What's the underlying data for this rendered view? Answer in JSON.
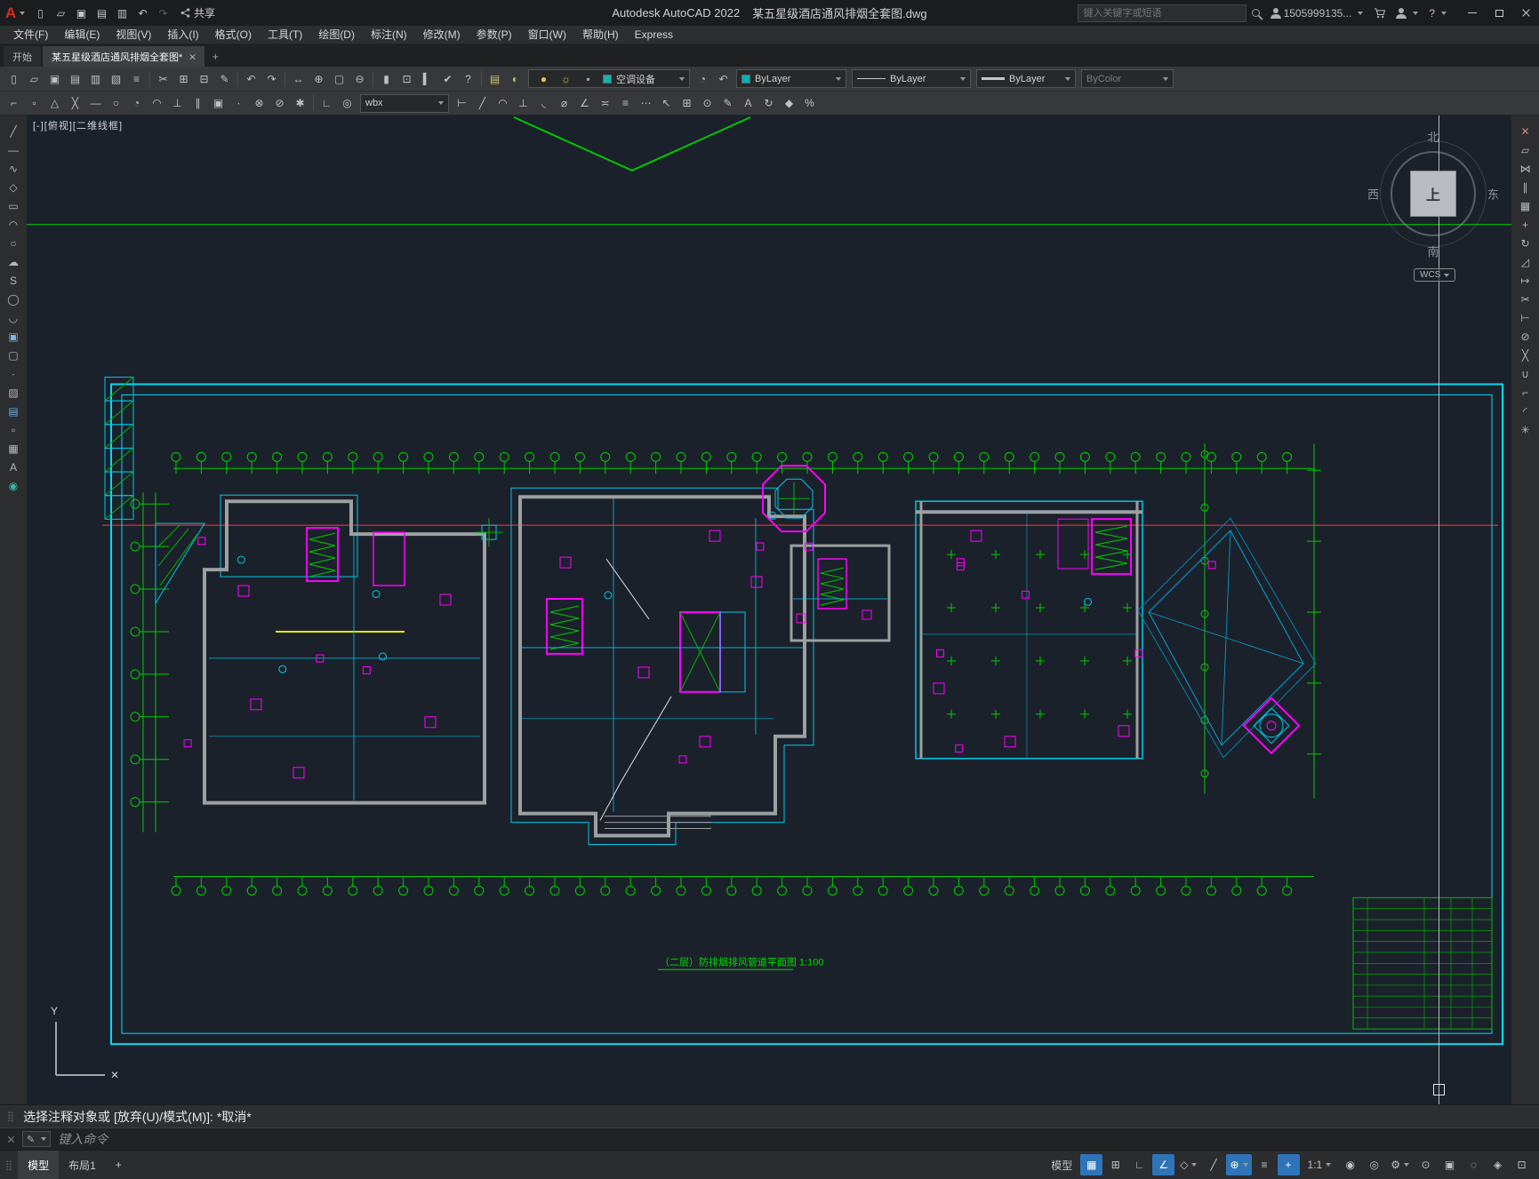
{
  "titlebar": {
    "logo_glyph": "A",
    "quick_access": [
      {
        "name": "new-file-icon",
        "glyph": "▯"
      },
      {
        "name": "open-file-icon",
        "glyph": "▱"
      },
      {
        "name": "save-icon",
        "glyph": "▣"
      },
      {
        "name": "save-as-icon",
        "glyph": "▤"
      },
      {
        "name": "plot-icon",
        "glyph": "▥"
      },
      {
        "name": "undo-icon",
        "glyph": "↶"
      },
      {
        "name": "redo-icon",
        "glyph": "↷",
        "disabled": true
      }
    ],
    "share_label": "共享",
    "app_title": "Autodesk AutoCAD 2022",
    "doc_title": "某五星级酒店通风排烟全套图.dwg",
    "search_placeholder": "键入关键字或短语",
    "account_name": "1505999135...",
    "help_label": "?"
  },
  "menubar": {
    "items": [
      "文件(F)",
      "编辑(E)",
      "视图(V)",
      "插入(I)",
      "格式(O)",
      "工具(T)",
      "绘图(D)",
      "标注(N)",
      "修改(M)",
      "参数(P)",
      "窗口(W)",
      "帮助(H)",
      "Express"
    ]
  },
  "filetabs": {
    "start_tab": "开始",
    "doc_tab": "某五星级酒店通风排烟全套图*",
    "new_tab_glyph": "+"
  },
  "toolbar1": {
    "icons": [
      {
        "name": "new-file-icon",
        "glyph": "▯"
      },
      {
        "name": "open-file-icon",
        "glyph": "▱"
      },
      {
        "name": "save-icon",
        "glyph": "▣"
      },
      {
        "name": "save-all-icon",
        "glyph": "▤"
      },
      {
        "name": "plot-icon",
        "glyph": "▥"
      },
      {
        "name": "plot-preview-icon",
        "glyph": "▧"
      },
      {
        "name": "publish-icon",
        "glyph": "≡"
      },
      {
        "sep": true
      },
      {
        "name": "cut-icon",
        "glyph": "✂"
      },
      {
        "name": "copy-clip-icon",
        "glyph": "⊞"
      },
      {
        "name": "paste-icon",
        "glyph": "⊟"
      },
      {
        "name": "match-properties-icon",
        "glyph": "✎"
      },
      {
        "sep": true
      },
      {
        "name": "undo-icon",
        "glyph": "↶"
      },
      {
        "name": "redo-icon",
        "glyph": "↷",
        "disabled": true
      },
      {
        "sep": true
      },
      {
        "name": "pan-icon",
        "glyph": "↔"
      },
      {
        "name": "zoom-realtime-icon",
        "glyph": "⊕"
      },
      {
        "name": "zoom-window-icon",
        "glyph": "▢"
      },
      {
        "name": "zoom-previous-icon",
        "glyph": "⊖"
      },
      {
        "sep": true
      },
      {
        "name": "properties-icon",
        "glyph": "▮"
      },
      {
        "name": "designcenter-icon",
        "glyph": "⊡"
      },
      {
        "name": "tool-palettes-icon",
        "glyph": "▍"
      },
      {
        "name": "markup-icon",
        "glyph": "✔"
      },
      {
        "name": "help-icon",
        "glyph": "?"
      }
    ],
    "layer_tools": [
      {
        "name": "layer-properties-icon",
        "glyph": "▤",
        "color": "#d3c06a"
      },
      {
        "name": "layer-states-icon",
        "glyph": "◐",
        "color": "#e0c84a"
      }
    ],
    "layer_dropdown": {
      "icons": [
        {
          "name": "layer-on-icon",
          "glyph": "●",
          "color": "#e8c33a"
        },
        {
          "name": "layer-thaw-icon",
          "glyph": "☼",
          "color": "#e8c33a"
        },
        {
          "name": "layer-lock-icon",
          "glyph": "▪",
          "color": "#9fb3bd"
        }
      ],
      "swatch": "#19b0b0",
      "value": "空调设备"
    },
    "after_layer_icons": [
      {
        "name": "layer-make-current-icon",
        "glyph": "◔"
      },
      {
        "name": "layer-previous-icon",
        "glyph": "↶"
      }
    ],
    "color_dropdown": {
      "swatch": "#00b0ba",
      "value": "ByLayer"
    },
    "linetype_dropdown": {
      "value": "ByLayer"
    },
    "lineweight_dropdown": {
      "value": "ByLayer"
    },
    "plotstyle_dropdown": {
      "value": "ByColor"
    }
  },
  "toolbar2": {
    "icons_left": [
      {
        "name": "osnap-from-icon",
        "glyph": "⌐"
      },
      {
        "name": "osnap-endpoint-icon",
        "glyph": "▫"
      },
      {
        "name": "osnap-midpoint-icon",
        "glyph": "△"
      },
      {
        "name": "osnap-intersection-icon",
        "glyph": "╳"
      },
      {
        "name": "osnap-extension-icon",
        "glyph": "—"
      },
      {
        "name": "osnap-center-icon",
        "glyph": "○"
      },
      {
        "name": "osnap-quadrant-icon",
        "glyph": "◔"
      },
      {
        "name": "osnap-tangent-icon",
        "glyph": "◠"
      },
      {
        "name": "osnap-perpendicular-icon",
        "glyph": "⊥"
      },
      {
        "name": "osnap-parallel-icon",
        "glyph": "∥"
      },
      {
        "name": "osnap-insert-icon",
        "glyph": "▣"
      },
      {
        "name": "osnap-node-icon",
        "glyph": "∙"
      },
      {
        "name": "osnap-nearest-icon",
        "glyph": "⊗"
      },
      {
        "name": "osnap-none-icon",
        "glyph": "⊘"
      },
      {
        "name": "osnap-settings-icon",
        "glyph": "✱"
      },
      {
        "sep": true
      },
      {
        "name": "ucs-icon",
        "glyph": "∟"
      },
      {
        "name": "ucs-world-icon",
        "glyph": "◎"
      }
    ],
    "style_dropdown": {
      "value": "wbx"
    },
    "icons_right": [
      {
        "name": "dim-linear-icon",
        "glyph": "⊢"
      },
      {
        "name": "dim-aligned-icon",
        "glyph": "╱"
      },
      {
        "name": "dim-arc-icon",
        "glyph": "◠"
      },
      {
        "name": "dim-ordinate-icon",
        "glyph": "⊥"
      },
      {
        "name": "dim-radius-icon",
        "glyph": "◟"
      },
      {
        "name": "dim-diameter-icon",
        "glyph": "⌀"
      },
      {
        "name": "dim-angular-icon",
        "glyph": "∠"
      },
      {
        "name": "quick-dim-icon",
        "glyph": "≍"
      },
      {
        "name": "dim-baseline-icon",
        "glyph": "≡"
      },
      {
        "name": "dim-continue-icon",
        "glyph": "⋯"
      },
      {
        "name": "leader-icon",
        "glyph": "↖"
      },
      {
        "name": "tolerance-icon",
        "glyph": "⊞"
      },
      {
        "name": "center-mark-icon",
        "glyph": "⊙"
      },
      {
        "name": "dim-edit-icon",
        "glyph": "✎"
      },
      {
        "name": "dim-text-edit-icon",
        "glyph": "A"
      },
      {
        "name": "dim-update-icon",
        "glyph": "↻"
      },
      {
        "name": "dim-style-icon",
        "glyph": "◆"
      },
      {
        "name": "scale-list-icon",
        "glyph": "%"
      }
    ]
  },
  "left_toolbar": {
    "icons": [
      {
        "name": "line-tool",
        "glyph": "╱"
      },
      {
        "name": "construction-line-tool",
        "glyph": "—"
      },
      {
        "name": "polyline-tool",
        "glyph": "∿"
      },
      {
        "name": "polygon-tool",
        "glyph": "◇"
      },
      {
        "name": "rectangle-tool",
        "glyph": "▭"
      },
      {
        "name": "arc-tool",
        "glyph": "◠"
      },
      {
        "name": "circle-tool",
        "glyph": "○"
      },
      {
        "name": "revision-cloud-tool",
        "glyph": "☁"
      },
      {
        "name": "spline-tool",
        "glyph": "S"
      },
      {
        "name": "ellipse-tool",
        "glyph": "◯"
      },
      {
        "name": "ellipse-arc-tool",
        "glyph": "◡"
      },
      {
        "name": "insert-block-tool",
        "glyph": "▣",
        "color": "#7fb2e5"
      },
      {
        "name": "make-block-tool",
        "glyph": "▢"
      },
      {
        "name": "point-tool",
        "glyph": "∙"
      },
      {
        "name": "hatch-tool",
        "glyph": "▨"
      },
      {
        "name": "gradient-tool",
        "glyph": "▤",
        "color": "#6fa8dc"
      },
      {
        "name": "region-tool",
        "glyph": "▫"
      },
      {
        "name": "table-tool",
        "glyph": "▦"
      },
      {
        "name": "mtext-tool",
        "glyph": "A"
      },
      {
        "name": "measure-tool",
        "glyph": "◉",
        "color": "#35b8a0"
      }
    ]
  },
  "right_toolbar": {
    "icons": [
      {
        "name": "erase-tool",
        "glyph": "✕",
        "color": "#d98a7a"
      },
      {
        "name": "copy-tool",
        "glyph": "▱"
      },
      {
        "name": "mirror-tool",
        "glyph": "⋈"
      },
      {
        "name": "offset-tool",
        "glyph": "∥"
      },
      {
        "name": "array-tool",
        "glyph": "▦"
      },
      {
        "name": "move-tool",
        "glyph": "+"
      },
      {
        "name": "rotate-tool",
        "glyph": "↻"
      },
      {
        "name": "scale-tool",
        "glyph": "◿"
      },
      {
        "name": "stretch-tool",
        "glyph": "↦"
      },
      {
        "name": "trim-tool",
        "glyph": "✂"
      },
      {
        "name": "extend-tool",
        "glyph": "⊢"
      },
      {
        "name": "break-point-tool",
        "glyph": "⊘"
      },
      {
        "name": "break-tool",
        "glyph": "╳"
      },
      {
        "name": "join-tool",
        "glyph": "∪"
      },
      {
        "name": "chamfer-tool",
        "glyph": "⌐"
      },
      {
        "name": "fillet-tool",
        "glyph": "◜"
      },
      {
        "name": "explode-tool",
        "glyph": "✳"
      }
    ]
  },
  "canvas": {
    "viewport_label": "[-][俯视][二维线框]",
    "plan_title": "（二层）防排烟排风管道平面图 1:100",
    "compass": {
      "north": "北",
      "south": "南",
      "west": "西",
      "east": "东",
      "top": "上"
    },
    "wcs_label": "WCS",
    "ucs": {
      "x_label": "✕",
      "y_label": "Y"
    }
  },
  "cmdline": {
    "history": "选择注释对象或 [放弃(U)/模式(M)]: *取消*",
    "placeholder": "键入命令"
  },
  "statusbar": {
    "model_tab": "模型",
    "layout_tab": "布局1",
    "new_layout_glyph": "+",
    "right_items": [
      {
        "name": "model-space-button",
        "label": "模型"
      },
      {
        "name": "grid-icon",
        "glyph": "▦",
        "active": true
      },
      {
        "name": "snap-icon",
        "glyph": "⊞"
      },
      {
        "name": "ortho-icon",
        "glyph": "∟"
      },
      {
        "name": "polar-icon",
        "glyph": "∠",
        "active": true
      },
      {
        "name": "isodraft-icon",
        "glyph": "◇",
        "dd": true
      },
      {
        "name": "otrack-icon",
        "glyph": "╱"
      },
      {
        "name": "osnap-icon",
        "glyph": "⊕",
        "active": true,
        "dd": true
      },
      {
        "name": "lineweight-icon",
        "glyph": "≡"
      },
      {
        "name": "dynamic-input-icon",
        "glyph": "+",
        "active": true
      },
      {
        "name": "annotation-scale-button",
        "label": "1:1",
        "dd": true
      },
      {
        "name": "annotation-visibility-icon",
        "glyph": "◉"
      },
      {
        "name": "autoscale-icon",
        "glyph": "◎"
      },
      {
        "name": "workspace-gear-icon",
        "glyph": "⚙",
        "dd": true
      },
      {
        "name": "annotation-monitor-icon",
        "glyph": "⊙"
      },
      {
        "name": "quick-properties-icon",
        "glyph": "▣"
      },
      {
        "name": "isolate-objects-icon",
        "glyph": "◌"
      },
      {
        "name": "graphics-performance-icon",
        "glyph": "◈"
      },
      {
        "name": "clean-screen-icon",
        "glyph": "⊡"
      }
    ]
  }
}
